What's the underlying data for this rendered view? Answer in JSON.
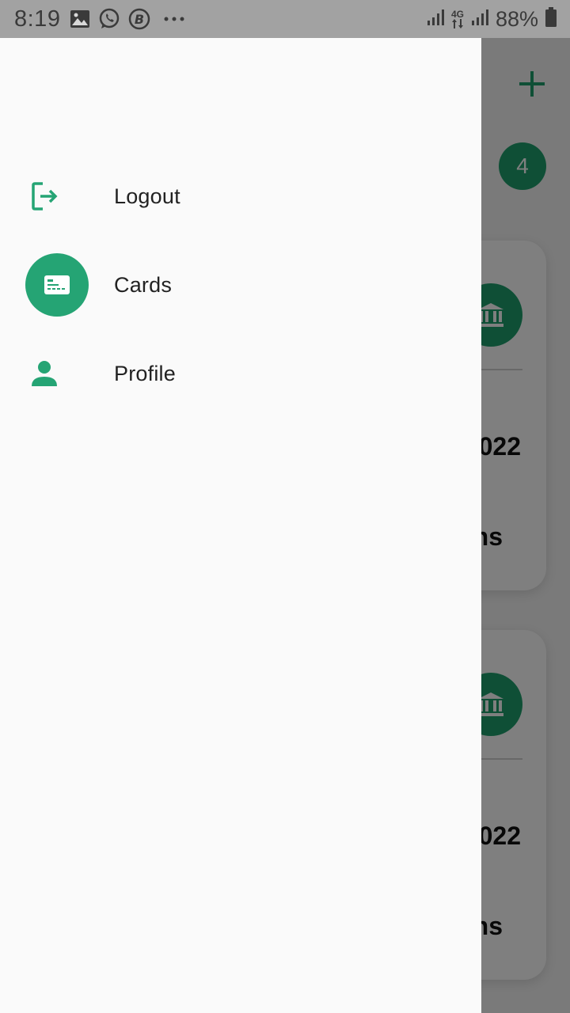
{
  "status_bar": {
    "time": "8:19",
    "notification_icons": [
      "image-icon",
      "whatsapp-icon",
      "b-circle-icon",
      "more-dots-icon"
    ],
    "network_label": "4G",
    "battery_text": "88%"
  },
  "drawer": {
    "items": [
      {
        "label": "Logout",
        "icon": "logout-icon",
        "active": false
      },
      {
        "label": "Cards",
        "icon": "card-icon",
        "active": true
      },
      {
        "label": "Profile",
        "icon": "person-icon",
        "active": false
      }
    ]
  },
  "background": {
    "badge_count": "4",
    "cards": [
      {
        "year_fragment": "022",
        "word_fragment": "ns"
      },
      {
        "year_fragment": "022",
        "word_fragment": "ns"
      }
    ]
  },
  "colors": {
    "accent": "#25a474",
    "drawer_bg": "#fafafa",
    "text": "#222222"
  }
}
